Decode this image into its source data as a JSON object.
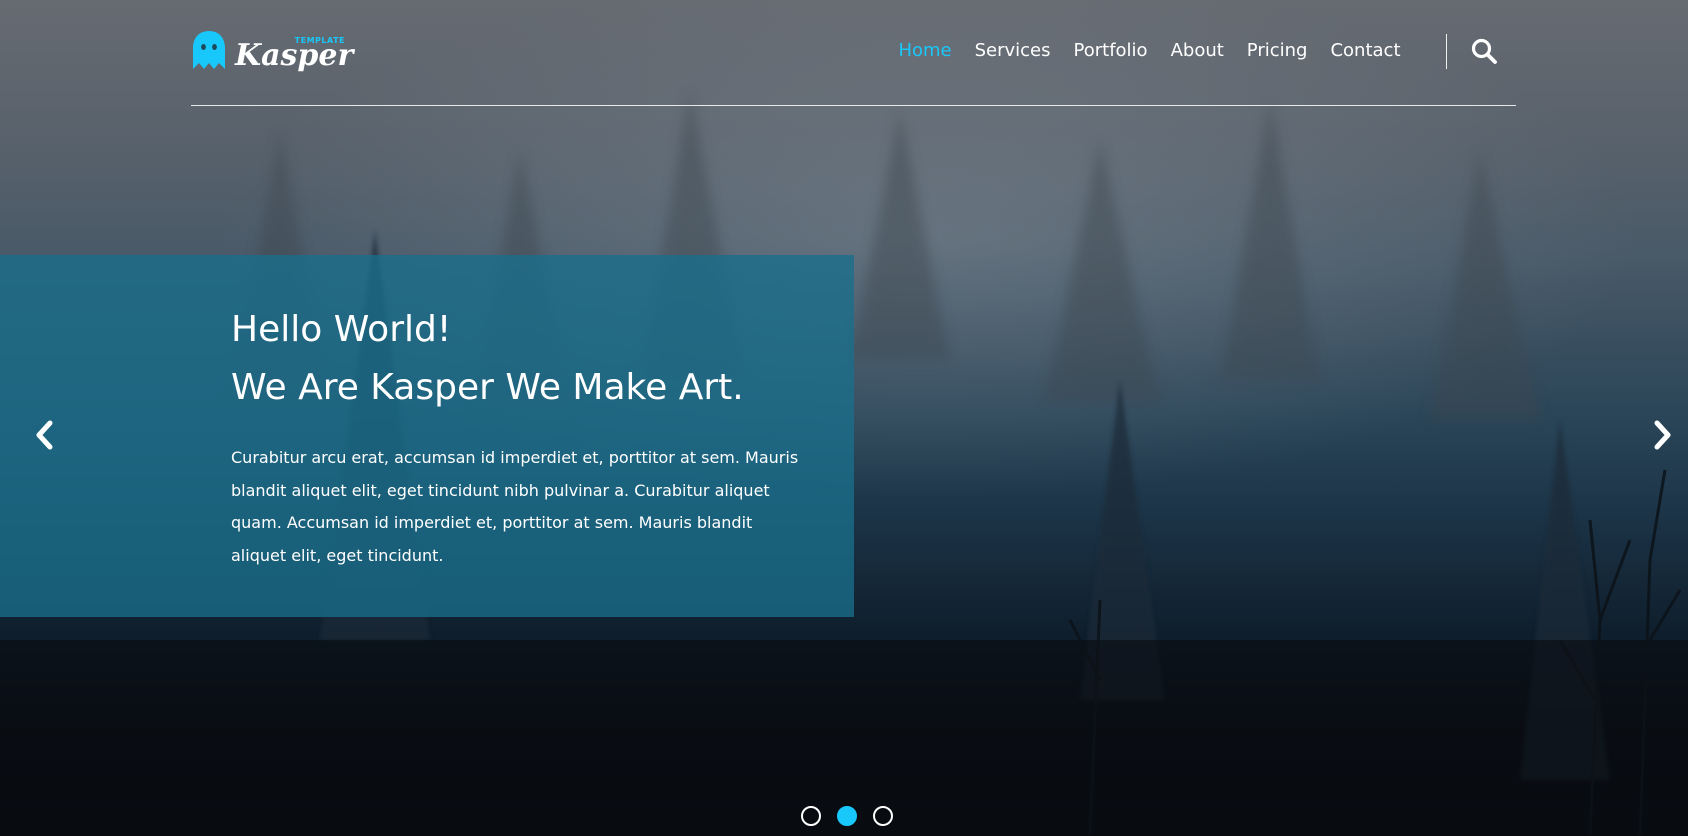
{
  "header": {
    "logo": {
      "name": "Kasper",
      "tagline": "TEMPLATE",
      "icon": "ghost-icon"
    },
    "nav": [
      {
        "label": "Home",
        "active": true
      },
      {
        "label": "Services",
        "active": false
      },
      {
        "label": "Portfolio",
        "active": false
      },
      {
        "label": "About",
        "active": false
      },
      {
        "label": "Pricing",
        "active": false
      },
      {
        "label": "Contact",
        "active": false
      }
    ],
    "search_icon": "search-icon"
  },
  "hero": {
    "title_line1": "Hello World!",
    "title_line2": "We Are Kasper We Make Art.",
    "description": "Curabitur arcu erat, accumsan id imperdiet et, porttitor at sem. Mauris blandit aliquet elit, eget tincidunt nibh pulvinar a. Curabitur aliquet quam. Accumsan id imperdiet et, porttitor at sem. Mauris blandit aliquet elit, eget tincidunt.",
    "prev_icon": "chevron-left-icon",
    "next_icon": "chevron-right-icon"
  },
  "slider": {
    "slides": 3,
    "active_index": 1
  },
  "colors": {
    "accent": "#19c8fa",
    "content_box": "#196e8c"
  }
}
